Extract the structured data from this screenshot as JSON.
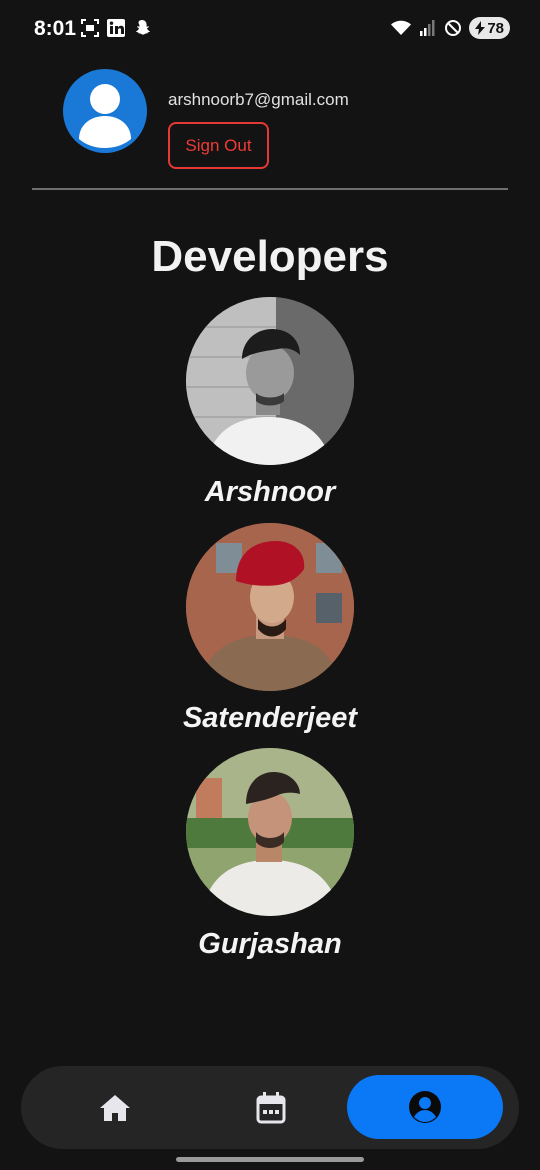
{
  "status_bar": {
    "time": "8:01",
    "battery": "78",
    "left_icons": [
      "screenshot-icon",
      "linkedin-icon",
      "snapchat-icon"
    ],
    "right_icons": [
      "wifi-icon",
      "signal-icon",
      "do-not-disturb-icon",
      "battery-icon"
    ]
  },
  "profile": {
    "email": "arshnoorb7@gmail.com",
    "sign_out_label": "Sign Out",
    "avatar_icon": "person-icon"
  },
  "developers": {
    "title": "Developers",
    "items": [
      {
        "name": "Arshnoor"
      },
      {
        "name": "Satenderjeet"
      },
      {
        "name": "Gurjashan"
      }
    ]
  },
  "bottom_nav": {
    "items": [
      {
        "icon": "home-icon",
        "active": false
      },
      {
        "icon": "calendar-icon",
        "active": false
      },
      {
        "icon": "profile-icon",
        "active": true
      }
    ]
  },
  "colors": {
    "background": "#131313",
    "accent": "#0b78f6",
    "danger": "#e53935",
    "avatar_bg": "#1a79d6"
  }
}
